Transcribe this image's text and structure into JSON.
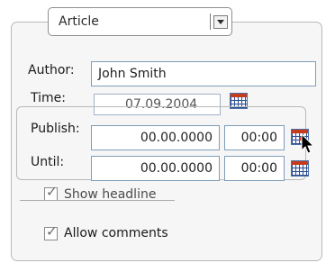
{
  "type_select": {
    "value": "Article"
  },
  "author": {
    "label": "Author:",
    "value": "John Smith"
  },
  "time": {
    "label": "Time:",
    "value": "07.09.2004"
  },
  "publish": {
    "label": "Publish:",
    "date": "00.00.0000",
    "time": "00:00"
  },
  "until": {
    "label": "Until:",
    "date": "00.00.0000",
    "time": "00:00"
  },
  "show_headline": {
    "label": "Show headline",
    "checked": true
  },
  "allow_comments": {
    "label": "Allow comments",
    "checked": true
  },
  "icons": {
    "calendar": "calendar-icon",
    "dropdown": "chevron-down-icon",
    "cursor": "mouse-pointer-icon"
  }
}
